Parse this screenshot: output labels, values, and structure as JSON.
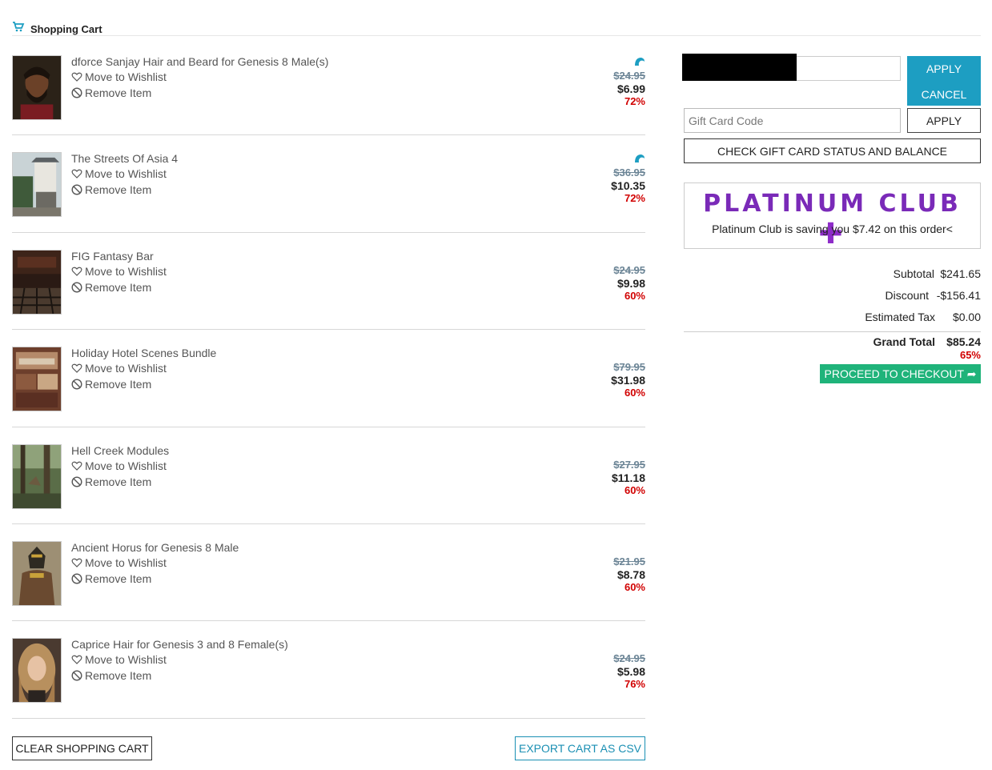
{
  "header": {
    "title": "Shopping Cart",
    "icon": "cart-icon",
    "accent": "#1d9ec2"
  },
  "items": [
    {
      "name": "dforce Sanjay Hair and Beard for Genesis 8 Male(s)",
      "wishlist": "Move to Wishlist",
      "remove": "Remove Item",
      "original_price": "$24.95",
      "sale_price": "$6.99",
      "discount": "72%",
      "badge": true,
      "thumb": "portrait-man"
    },
    {
      "name": "The Streets Of Asia 4",
      "wishlist": "Move to Wishlist",
      "remove": "Remove Item",
      "original_price": "$36.95",
      "sale_price": "$10.35",
      "discount": "72%",
      "badge": true,
      "thumb": "asian-street"
    },
    {
      "name": "FIG Fantasy Bar",
      "wishlist": "Move to Wishlist",
      "remove": "Remove Item",
      "original_price": "$24.95",
      "sale_price": "$9.98",
      "discount": "60%",
      "badge": false,
      "thumb": "bar-interior"
    },
    {
      "name": "Holiday Hotel Scenes Bundle",
      "wishlist": "Move to Wishlist",
      "remove": "Remove Item",
      "original_price": "$79.95",
      "sale_price": "$31.98",
      "discount": "60%",
      "badge": false,
      "thumb": "hotel"
    },
    {
      "name": "Hell Creek Modules",
      "wishlist": "Move to Wishlist",
      "remove": "Remove Item",
      "original_price": "$27.95",
      "sale_price": "$11.18",
      "discount": "60%",
      "badge": false,
      "thumb": "forest"
    },
    {
      "name": "Ancient Horus for Genesis 8 Male",
      "wishlist": "Move to Wishlist",
      "remove": "Remove Item",
      "original_price": "$21.95",
      "sale_price": "$8.78",
      "discount": "60%",
      "badge": false,
      "thumb": "horus"
    },
    {
      "name": "Caprice Hair for Genesis 3 and 8 Female(s)",
      "wishlist": "Move to Wishlist",
      "remove": "Remove Item",
      "original_price": "$24.95",
      "sale_price": "$5.98",
      "discount": "76%",
      "badge": false,
      "thumb": "woman-hair"
    }
  ],
  "buttons": {
    "clear_cart": "CLEAR SHOPPING CART",
    "export_csv": "EXPORT CART AS CSV",
    "apply": "APPLY",
    "cancel": "CANCEL",
    "gift_apply": "APPLY",
    "check_gift": "CHECK GIFT CARD STATUS AND BALANCE",
    "checkout": "PROCEED TO CHECKOUT"
  },
  "gift_card": {
    "placeholder": "Gift Card Code"
  },
  "platinum": {
    "logo": "PLATINUM CLUB",
    "message": "Platinum Club is saving you $7.42 on this order<"
  },
  "totals": {
    "subtotal_label": "Subtotal",
    "subtotal": "$241.65",
    "discount_label": "Discount",
    "discount": "-$156.41",
    "tax_label": "Estimated Tax",
    "tax": "$0.00",
    "grand_label": "Grand Total",
    "grand": "$85.24",
    "savings_pct": "65%"
  },
  "colors": {
    "teal": "#1d9ec2",
    "checkout_green": "#1fb37a",
    "discount_red": "#d10000",
    "platinum_purple": "#7a2ab8"
  }
}
